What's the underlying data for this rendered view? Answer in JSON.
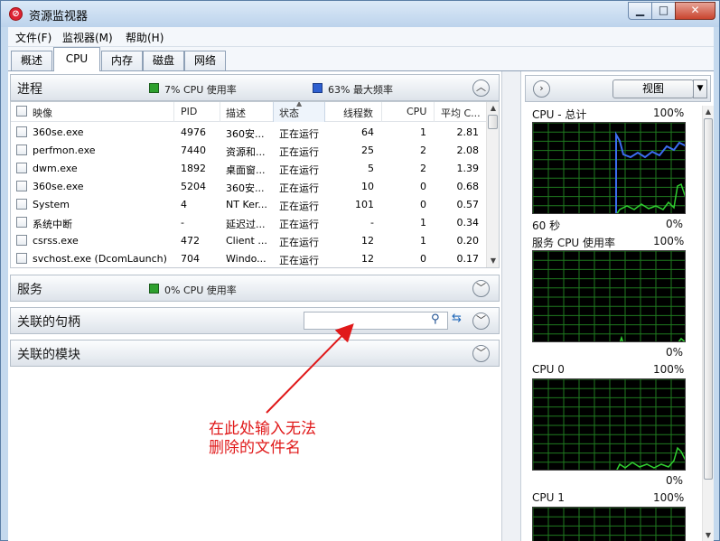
{
  "window": {
    "title": "资源监视器",
    "icon": "resource-monitor-icon",
    "minimize": "▁",
    "maximize": "□",
    "close": "✕"
  },
  "menu": [
    "文件(F)",
    "监视器(M)",
    "帮助(H)"
  ],
  "tabs": [
    "概述",
    "CPU",
    "内存",
    "磁盘",
    "网络"
  ],
  "active_tab": "CPU",
  "processes": {
    "title": "进程",
    "legend1": "7% CPU 使用率",
    "legend2": "63% 最大频率",
    "columns": [
      "映像",
      "PID",
      "描述",
      "状态",
      "线程数",
      "CPU",
      "平均 C..."
    ],
    "rows": [
      [
        "360se.exe",
        "4976",
        "360安...",
        "正在运行",
        "64",
        "1",
        "2.81"
      ],
      [
        "perfmon.exe",
        "7440",
        "资源和...",
        "正在运行",
        "25",
        "2",
        "2.08"
      ],
      [
        "dwm.exe",
        "1892",
        "桌面窗...",
        "正在运行",
        "5",
        "2",
        "1.39"
      ],
      [
        "360se.exe",
        "5204",
        "360安...",
        "正在运行",
        "10",
        "0",
        "0.68"
      ],
      [
        "System",
        "4",
        "NT Ker...",
        "正在运行",
        "101",
        "0",
        "0.57"
      ],
      [
        "系统中断",
        "-",
        "延迟过...",
        "正在运行",
        "-",
        "1",
        "0.34"
      ],
      [
        "csrss.exe",
        "472",
        "Client ...",
        "正在运行",
        "12",
        "1",
        "0.20"
      ],
      [
        "svchost.exe (DcomLaunch)",
        "704",
        "Windo...",
        "正在运行",
        "12",
        "0",
        "0.17"
      ]
    ]
  },
  "services": {
    "title": "服务",
    "legend": "0% CPU 使用率"
  },
  "handles": {
    "title": "关联的句柄",
    "search_value": ""
  },
  "modules": {
    "title": "关联的模块"
  },
  "annotation": {
    "line1": "在此处输入无法",
    "line2": "删除的文件名"
  },
  "right": {
    "view_label": "视图",
    "graphs": [
      {
        "label": "CPU - 总计",
        "max": "100%",
        "foot_left": "60 秒",
        "foot_right": "0%"
      },
      {
        "label": "服务 CPU 使用率",
        "max": "100%",
        "foot_right": "0%"
      },
      {
        "label": "CPU 0",
        "max": "100%",
        "foot_right": "0%"
      },
      {
        "label": "CPU 1",
        "max": "100%"
      }
    ]
  },
  "colors": {
    "cpu_usage": "#2ea02e",
    "max_frequency": "#2e5fd0",
    "annotation": "#e0191a"
  }
}
